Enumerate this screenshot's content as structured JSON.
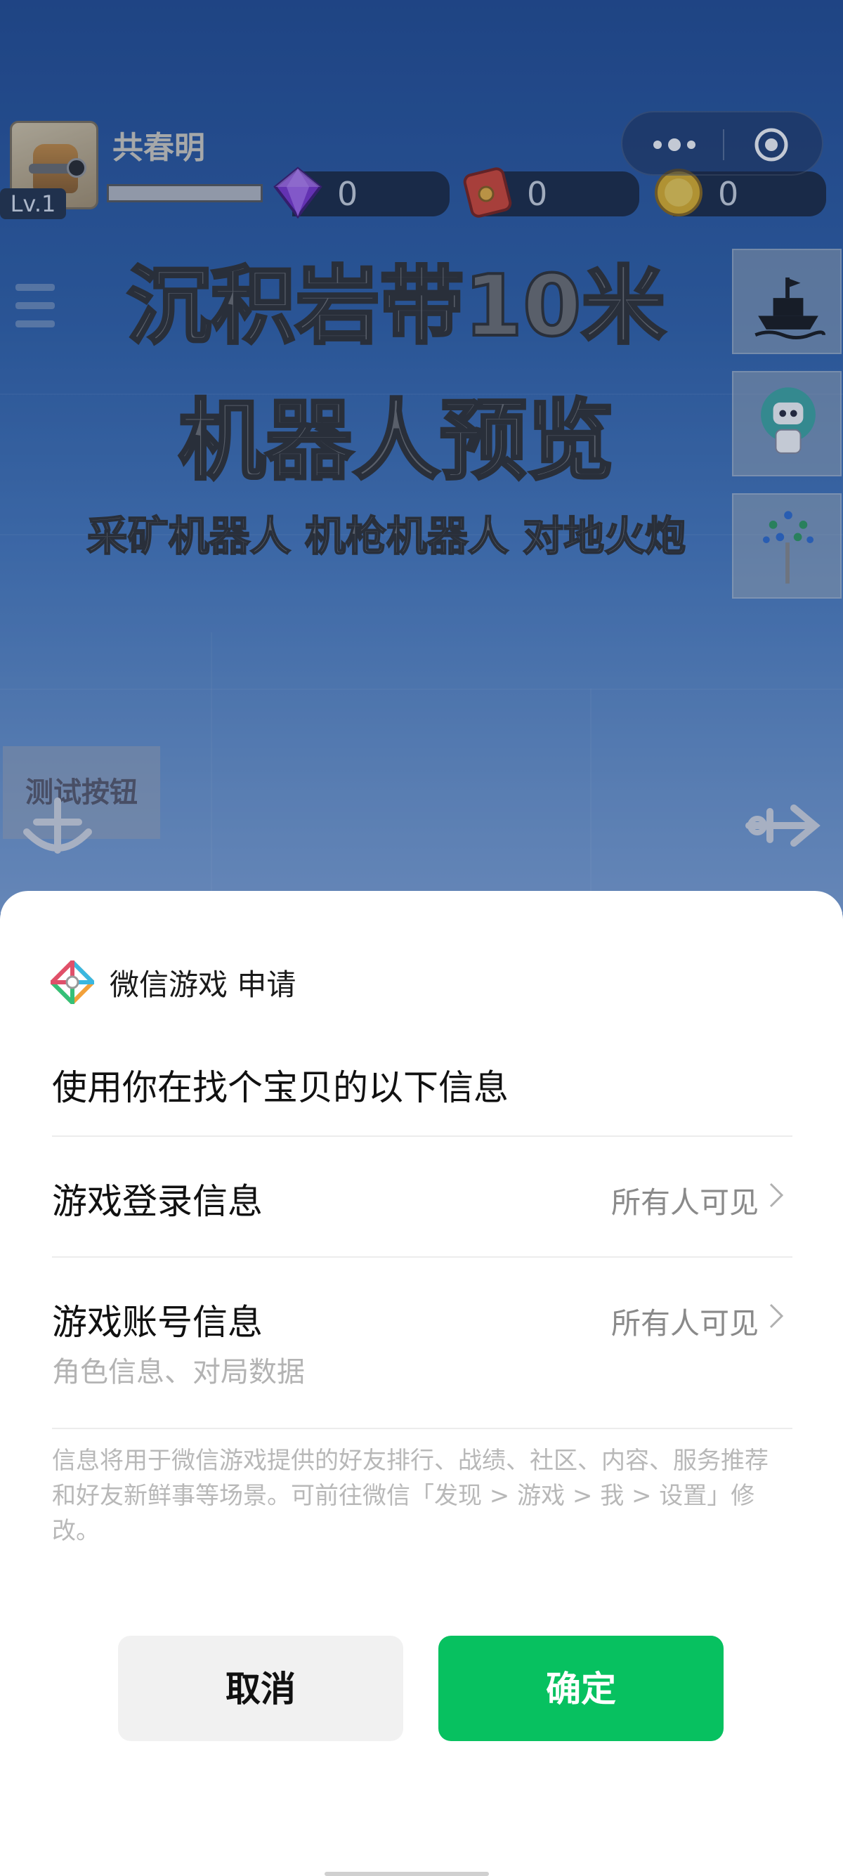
{
  "game": {
    "player_name": "共春明",
    "level": "Lv.1",
    "resources": [
      {
        "name": "gem",
        "icon": "diamond-icon",
        "count": "0",
        "color": "#8c3fe0"
      },
      {
        "name": "red-envelope",
        "icon": "red-packet-icon",
        "count": "0",
        "color": "#d9402b"
      },
      {
        "name": "coin",
        "icon": "coin-icon",
        "count": "0",
        "color": "#e5b320"
      }
    ],
    "banner": {
      "line1": "沉积岩带10米",
      "line2": "机器人预览",
      "line3": "采矿机器人 机枪机器人  对地火炮"
    },
    "side_buttons": [
      "ship-icon",
      "robot-icon",
      "tree-icon"
    ],
    "test_button": "测试按钮"
  },
  "sheet": {
    "app_name": "微信游戏 申请",
    "request_title": "使用你在找个宝贝的以下信息",
    "rows": [
      {
        "label": "游戏登录信息",
        "value": "所有人可见"
      },
      {
        "label": "游戏账号信息",
        "value": "所有人可见",
        "sub": "角色信息、对局数据"
      }
    ],
    "note": "信息将用于微信游戏提供的好友排行、战绩、社区、内容、服务推荐和好友新鲜事等场景。可前往微信「发现 > 游戏 > 我 > 设置」修改。",
    "cancel_label": "取消",
    "confirm_label": "确定",
    "accent": "#07c160"
  }
}
